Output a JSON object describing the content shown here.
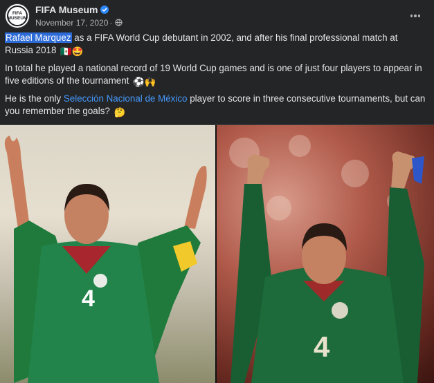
{
  "post": {
    "page_name": "FIFA Museum",
    "date": "November 17, 2020",
    "separator": "·",
    "avatar_lines": [
      "FIFA",
      "MUSEUM"
    ],
    "verified_icon": "verified-badge-icon",
    "audience_icon": "globe-icon",
    "more_icon": "more-options-icon",
    "paragraph1_highlight": "Rafael Marquez",
    "paragraph1_rest": " as a FIFA World Cup debutant in 2002, and after his final professional match at Russia 2018",
    "paragraph1_emoji": "🇲🇽🤩",
    "paragraph2": "In total he played a national record of 19 World Cup games and is one of just four players to appear in five editions of the tournament",
    "paragraph2_emoji": "⚽🙌",
    "paragraph3_prefix": "He is the only ",
    "paragraph3_link": "Selección Nacional de México",
    "paragraph3_suffix": " player to score in three consecutive tournaments, but can you remember the goals?",
    "paragraph3_emoji": "🤔"
  },
  "colors": {
    "background": "#242526",
    "text": "#e4e6eb",
    "secondary_text": "#b0b3b8",
    "link": "#4599ff",
    "highlight": "#2d6bd8",
    "verified": "#2d88ff"
  }
}
